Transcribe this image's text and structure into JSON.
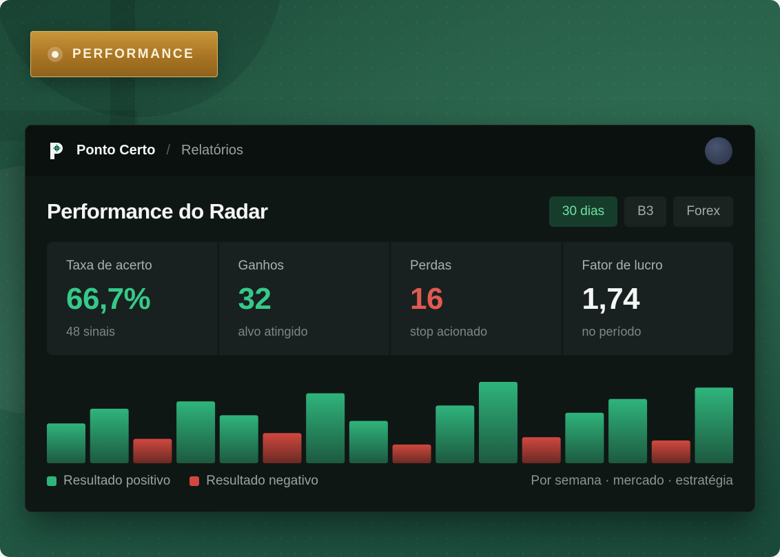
{
  "badge": {
    "label": "PERFORMANCE"
  },
  "topbar": {
    "brand": "Ponto Certo",
    "separator": "/",
    "breadcrumb": "Relatórios"
  },
  "header": {
    "title": "Performance do Radar",
    "filters": [
      {
        "label": "30 dias",
        "active": true
      },
      {
        "label": "B3",
        "active": false
      },
      {
        "label": "Forex",
        "active": false
      }
    ]
  },
  "stats": [
    {
      "label": "Taxa de acerto",
      "value": "66,7%",
      "sub": "48 sinais",
      "tone": "green"
    },
    {
      "label": "Ganhos",
      "value": "32",
      "sub": "alvo atingido",
      "tone": "green"
    },
    {
      "label": "Perdas",
      "value": "16",
      "sub": "stop acionado",
      "tone": "red"
    },
    {
      "label": "Fator de lucro",
      "value": "1,74",
      "sub": "no período",
      "tone": "white"
    }
  ],
  "chart_data": {
    "type": "bar",
    "values": [
      0.49,
      0.67,
      0.3,
      0.76,
      0.59,
      0.37,
      0.86,
      0.52,
      0.23,
      0.71,
      1.0,
      0.32,
      0.62,
      0.79,
      0.28,
      0.93
    ],
    "signs": [
      "positive",
      "positive",
      "negative",
      "positive",
      "positive",
      "negative",
      "positive",
      "positive",
      "negative",
      "positive",
      "positive",
      "negative",
      "positive",
      "positive",
      "negative",
      "positive"
    ],
    "colors": {
      "positive": "#2fb47c",
      "negative": "#d0483f"
    }
  },
  "legend": {
    "positive": "Resultado positivo",
    "negative": "Resultado negativo",
    "note": "Por semana · mercado · estratégia"
  }
}
